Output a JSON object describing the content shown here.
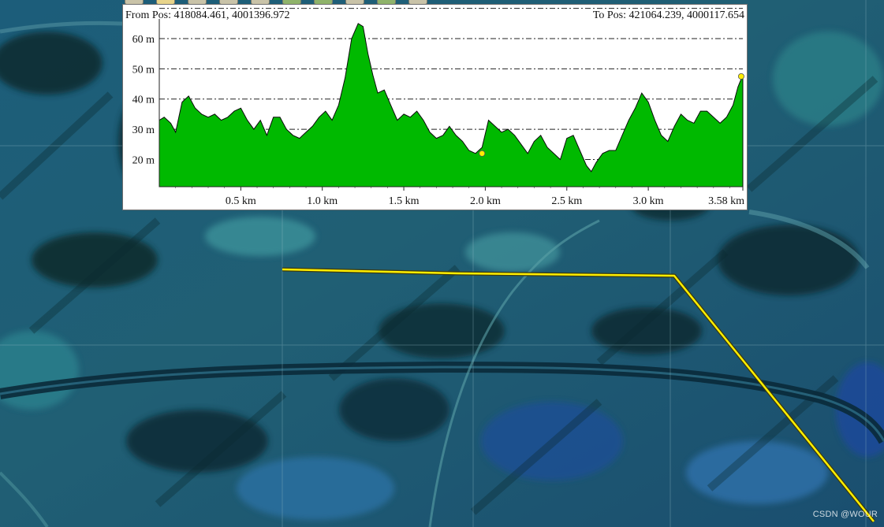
{
  "profile_window": {
    "from_pos": "From Pos: 418084.461, 4001396.972",
    "to_pos": "To Pos: 421064.239, 4000117.654"
  },
  "colors": {
    "profile_fill": "#00b900",
    "route_line": "#ffee00",
    "marker": "#ffee00"
  },
  "watermark": "CSDN @WOUR",
  "chart_data": {
    "type": "area",
    "title": "",
    "xlabel": "",
    "ylabel": "",
    "x_unit": "km",
    "y_unit": "m",
    "xlim": [
      0,
      3.58
    ],
    "ylim": [
      11,
      66
    ],
    "x_ticks": [
      {
        "value": 0.5,
        "label": "0.5 km"
      },
      {
        "value": 1.0,
        "label": "1.0 km"
      },
      {
        "value": 1.5,
        "label": "1.5 km"
      },
      {
        "value": 2.0,
        "label": "2.0 km"
      },
      {
        "value": 2.5,
        "label": "2.5 km"
      },
      {
        "value": 3.0,
        "label": "3.0 km"
      },
      {
        "value": 3.58,
        "label": "3.58 km"
      }
    ],
    "y_ticks": [
      {
        "value": 20,
        "label": "20 m"
      },
      {
        "value": 30,
        "label": "30 m"
      },
      {
        "value": 40,
        "label": "40 m"
      },
      {
        "value": 50,
        "label": "50 m"
      },
      {
        "value": 60,
        "label": "60 m"
      }
    ],
    "grid": "horizontal dash-dot",
    "markers": [
      {
        "x": 1.98,
        "y": 22
      },
      {
        "x": 3.57,
        "y": 47.5
      }
    ],
    "series": [
      {
        "x": [
          0.0,
          0.03,
          0.07,
          0.1,
          0.14,
          0.18,
          0.22,
          0.26,
          0.3,
          0.34,
          0.38,
          0.42,
          0.46,
          0.5,
          0.54,
          0.58,
          0.62,
          0.66,
          0.7,
          0.74,
          0.78,
          0.82,
          0.86,
          0.9,
          0.94,
          0.98,
          1.02,
          1.06,
          1.1,
          1.14,
          1.18,
          1.22,
          1.25,
          1.28,
          1.31,
          1.34,
          1.38,
          1.42,
          1.46,
          1.5,
          1.54,
          1.58,
          1.62,
          1.66,
          1.7,
          1.74,
          1.78,
          1.82,
          1.86,
          1.9,
          1.94,
          1.98,
          2.02,
          2.06,
          2.1,
          2.14,
          2.18,
          2.22,
          2.26,
          2.3,
          2.34,
          2.38,
          2.42,
          2.46,
          2.5,
          2.54,
          2.58,
          2.62,
          2.65,
          2.68,
          2.72,
          2.76,
          2.8,
          2.84,
          2.88,
          2.92,
          2.96,
          3.0,
          3.04,
          3.08,
          3.12,
          3.16,
          3.2,
          3.24,
          3.28,
          3.32,
          3.36,
          3.4,
          3.44,
          3.48,
          3.52,
          3.55,
          3.58
        ],
        "y": [
          33,
          34,
          32,
          29,
          39,
          41,
          37,
          35,
          34,
          35,
          33,
          34,
          36,
          37,
          33,
          30,
          33,
          28,
          34,
          34,
          30,
          28,
          27,
          29,
          31,
          34,
          36,
          33,
          38,
          47,
          60,
          65,
          64,
          55,
          48,
          42,
          43,
          38,
          33,
          35,
          34,
          36,
          33,
          29,
          27,
          28,
          31,
          28,
          26,
          23,
          22,
          24,
          33,
          31,
          29,
          30,
          28,
          25,
          22,
          26,
          28,
          24,
          22,
          20,
          27,
          28,
          23,
          18,
          16,
          19,
          22,
          23,
          23,
          28,
          33,
          37,
          42,
          39,
          33,
          28,
          26,
          31,
          35,
          33,
          32,
          36,
          36,
          34,
          32,
          34,
          38,
          44,
          48
        ]
      }
    ]
  }
}
